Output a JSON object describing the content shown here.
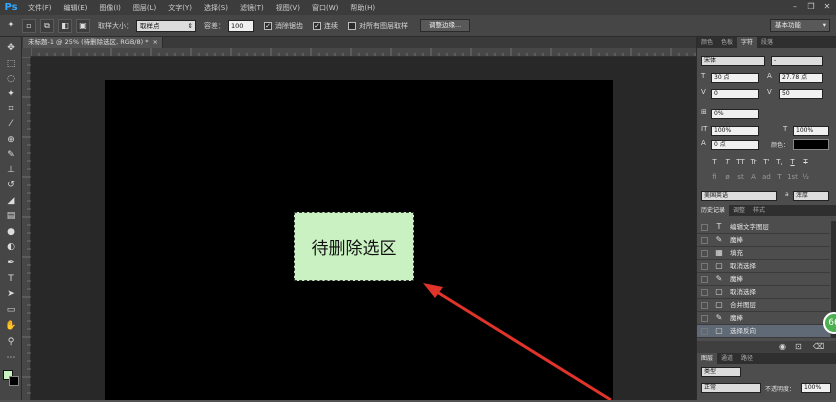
{
  "menubar": {
    "logo": "Ps",
    "items": [
      "文件(F)",
      "编辑(E)",
      "图像(I)",
      "图层(L)",
      "文字(Y)",
      "选择(S)",
      "滤镜(T)",
      "视图(V)",
      "窗口(W)",
      "帮助(H)"
    ]
  },
  "options": {
    "sample_size_label": "取样大小：",
    "sample_size_value": "取样点",
    "tolerance_label": "容差：",
    "tolerance_value": "100",
    "antialias_label": "消除锯齿",
    "contiguous_label": "连续",
    "all_layers_label": "对所有图层取样",
    "refine_edge_label": "调整边缘...",
    "workspace": "基本功能"
  },
  "document": {
    "tab_title": "未标题-1 @ 25% (待删除选区, RGB/8) *",
    "selection_text": "待删除选区"
  },
  "character_panel": {
    "tabs": [
      "颜色",
      "色板",
      "字符",
      "段落"
    ],
    "font_family": "宋体",
    "font_style": "-",
    "font_size": "30 点",
    "leading": "27.78 点",
    "kerning": "0",
    "tracking": "50",
    "scale_percent": "0%",
    "vertical_scale": "100%",
    "horizontal_scale": "100%",
    "baseline_shift": "0 点",
    "color_label": "颜色：",
    "language": "美国英语",
    "antialias": "浑厚",
    "style_buttons": [
      "T",
      "T",
      "TT",
      "Tr",
      "T'",
      "T,",
      "T",
      "T"
    ],
    "otype_buttons": [
      "fi",
      "ø",
      "st",
      "A",
      "ad",
      "T",
      "1st",
      "½"
    ]
  },
  "history_panel": {
    "tabs": [
      "历史记录",
      "调整",
      "样式"
    ],
    "items": [
      {
        "icon": "T",
        "label": "编辑文字图层"
      },
      {
        "icon": "✎",
        "label": "魔棒"
      },
      {
        "icon": "▦",
        "label": "填充"
      },
      {
        "icon": "▢",
        "label": "取消选择"
      },
      {
        "icon": "✎",
        "label": "魔棒"
      },
      {
        "icon": "▢",
        "label": "取消选择"
      },
      {
        "icon": "▢",
        "label": "合并图层"
      },
      {
        "icon": "✎",
        "label": "魔棒"
      },
      {
        "icon": "▢",
        "label": "选择反向"
      }
    ]
  },
  "layers_panel": {
    "tabs": [
      "图层",
      "通道",
      "路径"
    ],
    "kind_label": "类型",
    "blend_mode": "正常",
    "opacity_label": "不透明度：",
    "opacity_value": "100%"
  },
  "colors": {
    "selection_fill": "#c9f1c2",
    "arrow": "#e0342b",
    "foreground_swatch": "#c9f1c2",
    "background_swatch": "#000000"
  },
  "badge": "66"
}
